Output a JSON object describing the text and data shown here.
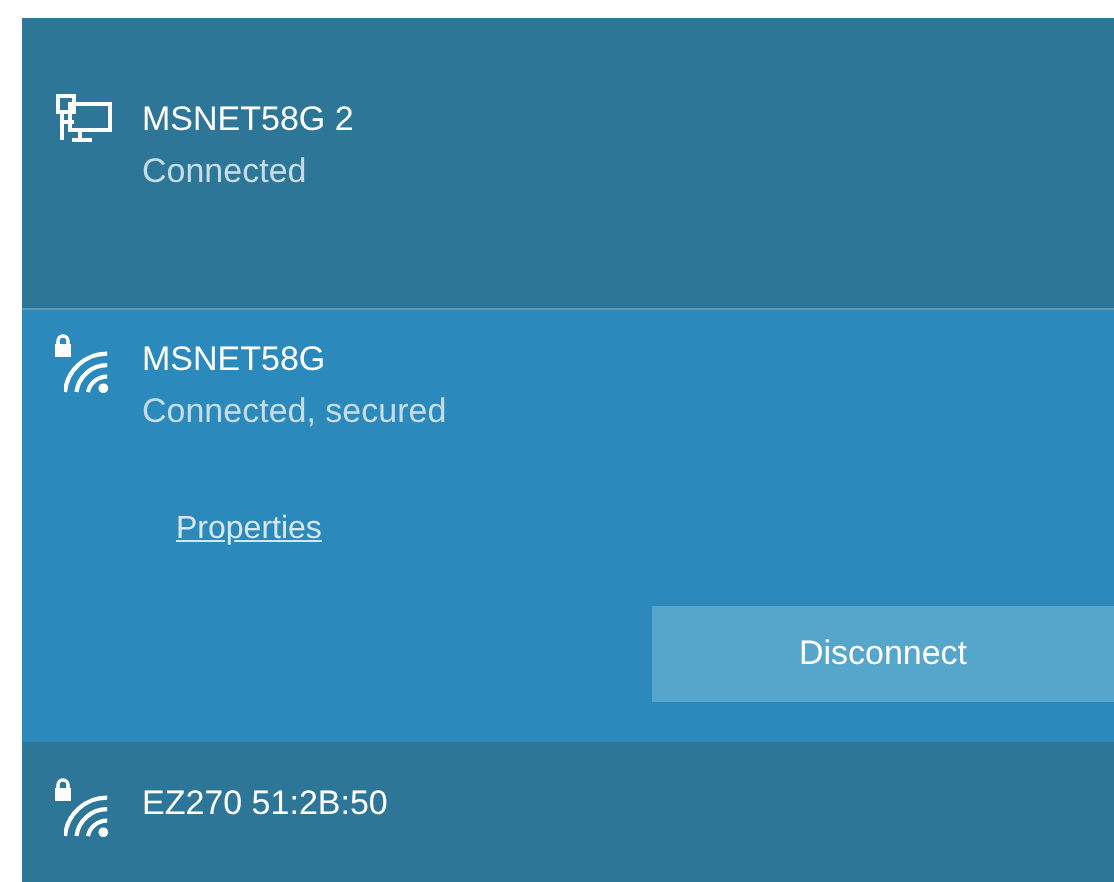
{
  "networks": [
    {
      "kind": "wired",
      "name": "MSNET58G 2",
      "status": "Connected",
      "secured": false,
      "selected": false
    },
    {
      "kind": "wifi",
      "name": "MSNET58G",
      "status": "Connected, secured",
      "secured": true,
      "selected": true,
      "link": "Properties",
      "button": "Disconnect"
    },
    {
      "kind": "wifi",
      "name": "EZ270 51:2B:50",
      "secured": true,
      "selected": false
    }
  ]
}
